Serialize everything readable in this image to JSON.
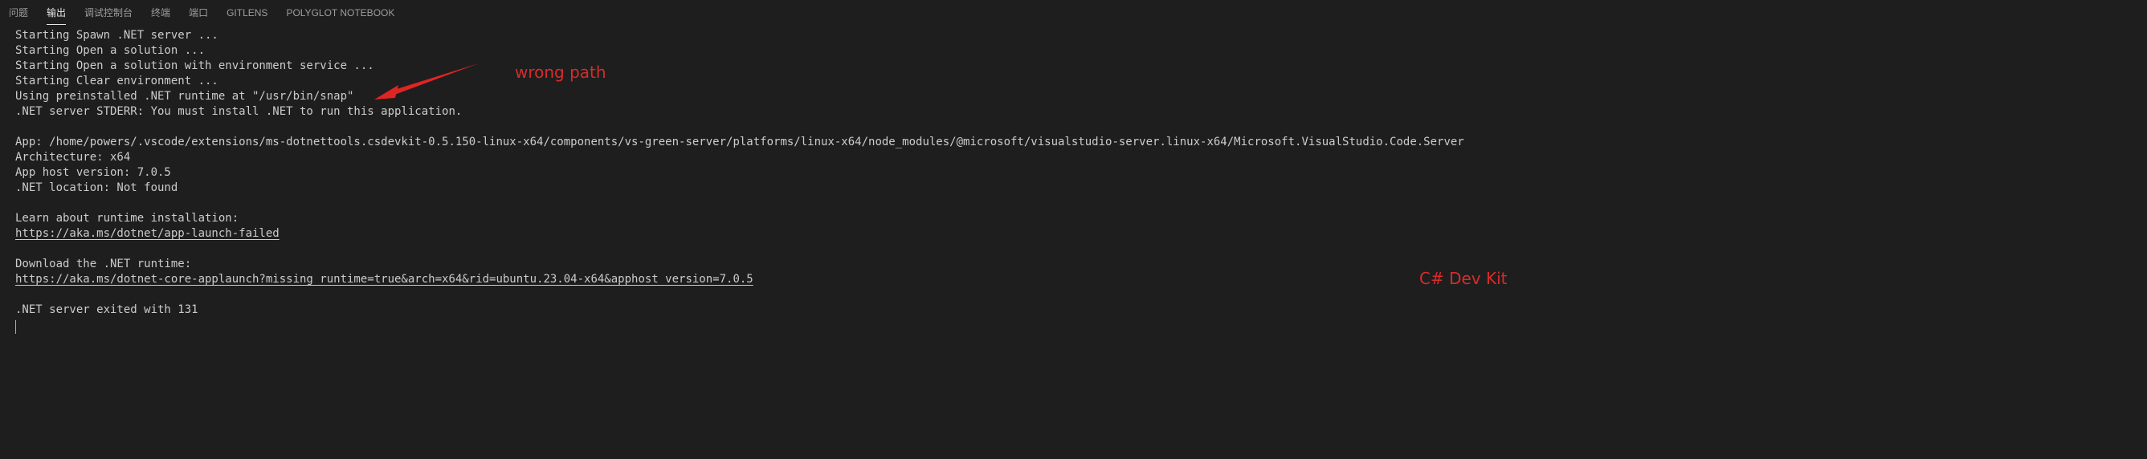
{
  "tabs": [
    {
      "label": "问题",
      "active": false
    },
    {
      "label": "输出",
      "active": true
    },
    {
      "label": "调试控制台",
      "active": false
    },
    {
      "label": "终端",
      "active": false
    },
    {
      "label": "端口",
      "active": false
    },
    {
      "label": "GITLENS",
      "active": false
    },
    {
      "label": "POLYGLOT NOTEBOOK",
      "active": false
    }
  ],
  "output": {
    "lines": [
      "Starting Spawn .NET server ...",
      "Starting Open a solution ...",
      "Starting Open a solution with environment service ...",
      "Starting Clear environment ...",
      "Using preinstalled .NET runtime at \"/usr/bin/snap\"",
      ".NET server STDERR: You must install .NET to run this application.",
      "",
      "App: /home/powers/.vscode/extensions/ms-dotnettools.csdevkit-0.5.150-linux-x64/components/vs-green-server/platforms/linux-x64/node_modules/@microsoft/visualstudio-server.linux-x64/Microsoft.VisualStudio.Code.Server",
      "Architecture: x64",
      "App host version: 7.0.5",
      ".NET location: Not found",
      "",
      "Learn about runtime installation:",
      "https://aka.ms/dotnet/app-launch-failed",
      "",
      "Download the .NET runtime:",
      "https://aka.ms/dotnet-core-applaunch?missing_runtime=true&arch=x64&rid=ubuntu.23.04-x64&apphost_version=7.0.5",
      "",
      ".NET server exited with 131"
    ]
  },
  "annotations": {
    "wrong_path": "wrong path",
    "dev_kit": "C# Dev Kit",
    "color": "#d92b2b"
  },
  "colors": {
    "background": "#1e1e1e",
    "text": "#cccccc",
    "active_tab": "#e7e7e7",
    "inactive_tab": "#9d9d9d"
  }
}
